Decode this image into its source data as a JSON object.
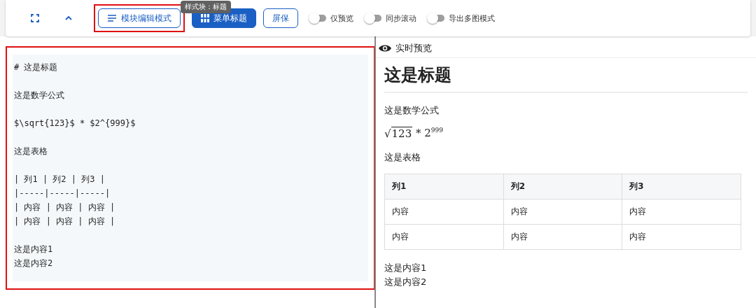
{
  "toolbar": {
    "buttons": [
      {
        "kind": "outlined",
        "label": "模块编辑模式",
        "highlighted": true
      },
      {
        "kind": "filled",
        "label": "菜单标题"
      },
      {
        "kind": "outlined",
        "label": "屏保"
      }
    ],
    "toggles": [
      {
        "label": "仅预览",
        "on": false
      },
      {
        "label": "同步滚动",
        "on": false
      },
      {
        "label": "导出多图模式",
        "on": false
      }
    ],
    "tooltip": "样式块：标题"
  },
  "editor": {
    "highlighted": true,
    "blocks": [
      [
        "# 这是标题"
      ],
      [
        "这是数学公式"
      ],
      [
        "$\\sqrt{123}$ * $2^{999}$"
      ],
      [
        "这是表格"
      ],
      [
        "| 列1 | 列2 | 列3 |",
        "|-----|-----|-----|",
        "| 内容 | 内容 | 内容 |",
        "| 内容 | 内容 | 内容 |"
      ],
      [
        "这是内容1",
        "这是内容2"
      ]
    ]
  },
  "preview": {
    "title": "实时预览",
    "heading": "这是标题",
    "paragraph_1": "这是数学公式",
    "math": {
      "radical": "√",
      "radicand": "123",
      "operator": "*",
      "base": "2",
      "exponent": "999"
    },
    "paragraph_2": "这是表格",
    "table": {
      "columns": [
        "列1",
        "列2",
        "列3"
      ],
      "rows": [
        [
          "内容",
          "内容",
          "内容"
        ],
        [
          "内容",
          "内容",
          "内容"
        ]
      ]
    },
    "footer_lines": [
      "这是内容1",
      "这是内容2"
    ]
  }
}
